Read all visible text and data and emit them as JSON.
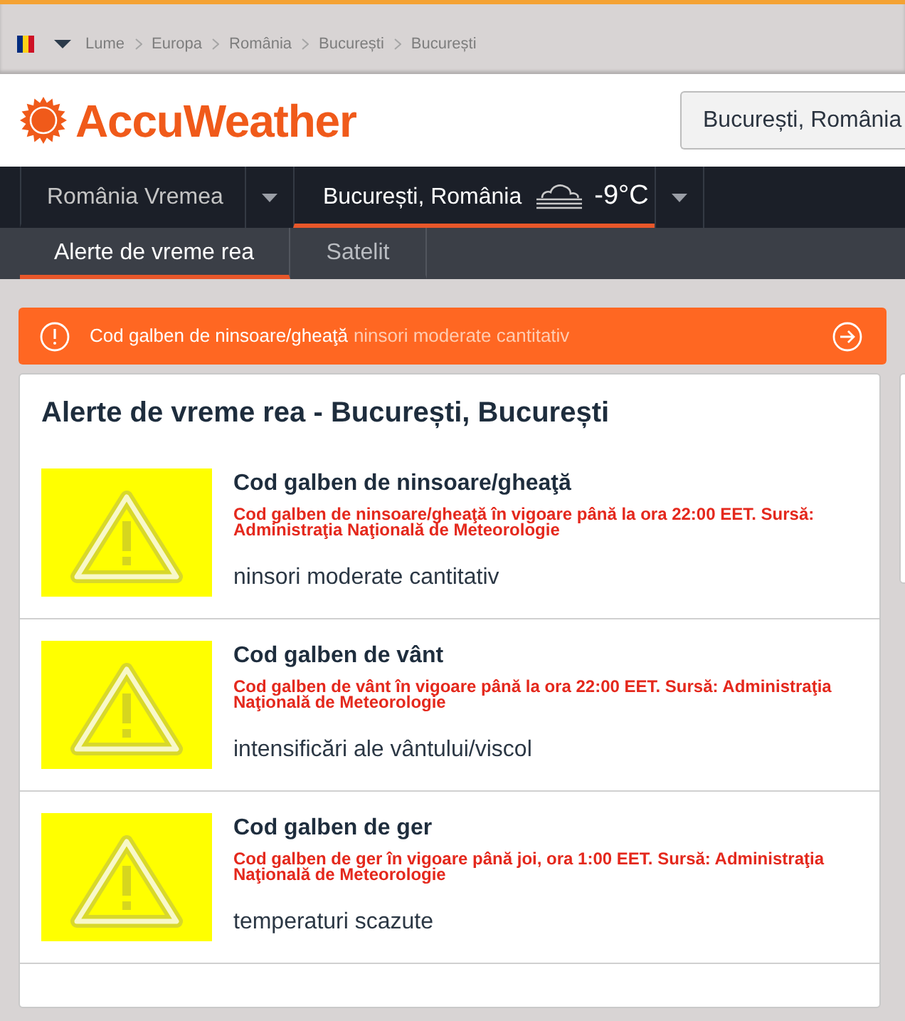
{
  "top_bar": {
    "breadcrumb": [
      {
        "label": "Lume"
      },
      {
        "label": "Europa"
      },
      {
        "label": "România"
      },
      {
        "label": "București"
      },
      {
        "label": "București"
      }
    ]
  },
  "header": {
    "logo": "AccuWeather",
    "search": {
      "value": "București, România"
    }
  },
  "nav": {
    "items": [
      {
        "kind": "link",
        "label": "România Vremea",
        "selected": false
      },
      {
        "kind": "location",
        "label": "București, România",
        "temperature": "-9°C",
        "selected": true
      }
    ]
  },
  "subnav": {
    "tabs": [
      {
        "label": "Alerte de vreme rea",
        "selected": true
      },
      {
        "label": "Satelit",
        "selected": false
      }
    ]
  },
  "banner": {
    "title": "Cod galben de ninsoare/gheaţă",
    "detail": "ninsori moderate cantitativ"
  },
  "alerts_panel": {
    "title": "Alerte de vreme rea - București, București",
    "alerts": [
      {
        "color": "#ffff00",
        "title": "Cod galben de ninsoare/gheaţă",
        "notice": "Cod galben de ninsoare/gheaţă în vigoare până la ora 22:00 EET. Sursă: Administraţia Naţională de Meteorologie",
        "description": "ninsori moderate cantitativ"
      },
      {
        "color": "#ffff00",
        "title": "Cod galben de vânt",
        "notice": "Cod galben de vânt în vigoare până la ora 22:00 EET. Sursă: Administraţia Naţională de Meteorologie",
        "description": "intensificări ale vântului/viscol"
      },
      {
        "color": "#ffff00",
        "title": "Cod galben de ger",
        "notice": "Cod galben de ger în vigoare până joi, ora 1:00 EET. Sursă: Administraţia Naţională de Meteorologie",
        "description": "temperaturi scazute"
      }
    ]
  }
}
